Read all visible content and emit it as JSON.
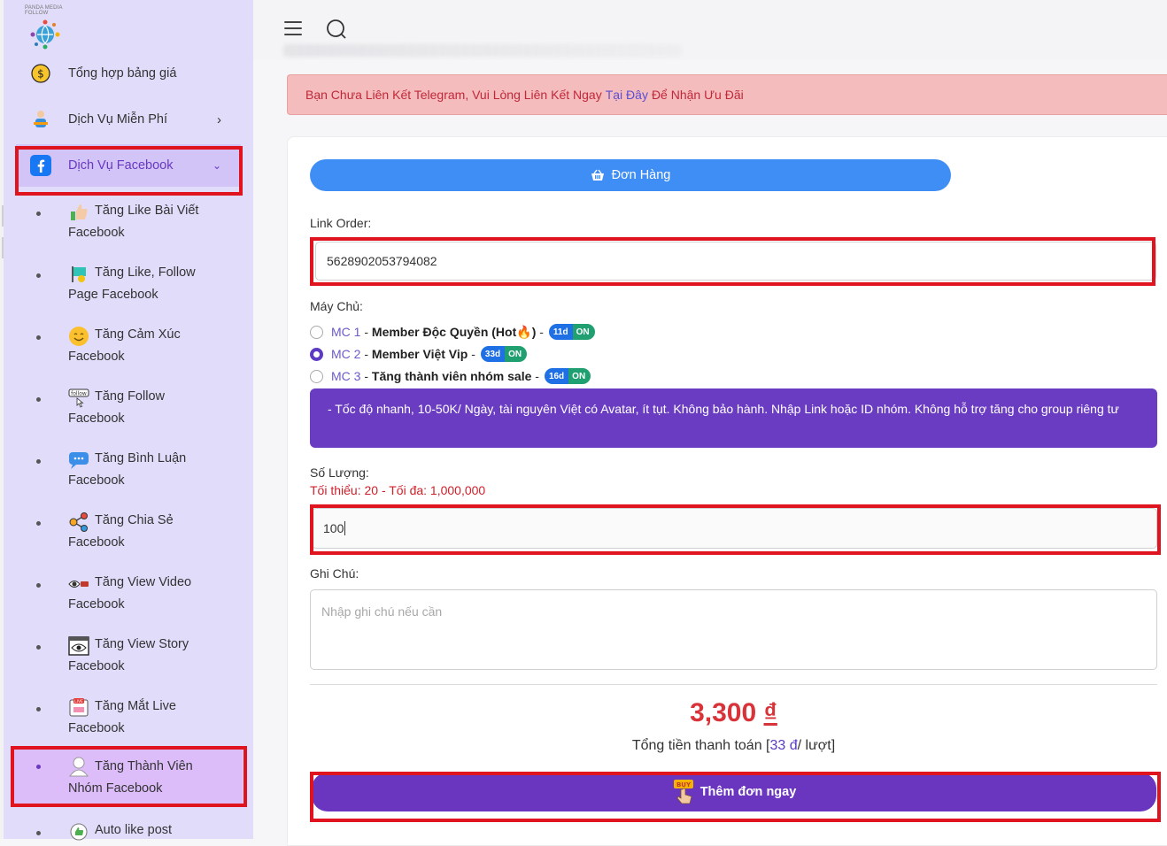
{
  "sidebar": {
    "logo_text": "PANDA MEDIA FOLLOW",
    "items": [
      {
        "label": "Tổng hợp bảng giá",
        "icon": "dollar-coin-icon"
      },
      {
        "label": "Dịch Vụ Miễn Phí",
        "icon": "free-service-icon",
        "chevron": "›"
      },
      {
        "label": "Dịch Vụ Facebook",
        "icon": "facebook-icon",
        "chevron": "⌄"
      }
    ],
    "subitems": [
      {
        "line1": "Tăng Like Bài Viết",
        "line2": "Facebook",
        "icon": "thumbs-up-icon"
      },
      {
        "line1": "Tăng Like, Follow",
        "line2": "Page Facebook",
        "icon": "flag-icon"
      },
      {
        "line1": "Tăng Cảm Xúc",
        "line2": "Facebook",
        "icon": "emoji-icon"
      },
      {
        "line1": "Tăng Follow",
        "line2": "Facebook",
        "icon": "follow-icon"
      },
      {
        "line1": "Tăng Bình Luận",
        "line2": "Facebook",
        "icon": "comment-icon"
      },
      {
        "line1": "Tăng Chia Sẻ",
        "line2": "Facebook",
        "icon": "share-icon"
      },
      {
        "line1": "Tăng View Video",
        "line2": "Facebook",
        "icon": "eye-icon"
      },
      {
        "line1": "Tăng View Story",
        "line2": "Facebook",
        "icon": "story-eye-icon"
      },
      {
        "line1": "Tăng Mắt Live",
        "line2": "Facebook",
        "icon": "live-icon"
      },
      {
        "line1": "Tăng Thành Viên",
        "line2": "Nhóm Facebook",
        "icon": "member-icon"
      },
      {
        "line1": "Auto like post",
        "line2": "",
        "icon": "auto-like-icon"
      }
    ]
  },
  "alert": {
    "before": "Bạn Chưa Liên Kết Telegram, Vui Lòng Liên Kết Ngay",
    "link": "Tại Đây",
    "after": "Để Nhận Ưu Đãi"
  },
  "form": {
    "order_button": "Đơn Hàng",
    "link_label": "Link Order:",
    "link_value": "5628902053794082",
    "server_label": "Máy Chủ:",
    "servers": [
      {
        "code": "MC 1",
        "name": "Member Độc Quyền (Hot🔥)",
        "days": "11d",
        "status": "ON",
        "selected": false
      },
      {
        "code": "MC 2",
        "name": "Member Việt Vip",
        "days": "33d",
        "status": "ON",
        "selected": true
      },
      {
        "code": "MC 3",
        "name": "Tăng thành viên nhóm sale",
        "days": "16d",
        "status": "ON",
        "selected": false
      }
    ],
    "description": "- Tốc độ nhanh, 10-50K/ Ngày, tài nguyên Việt có Avatar, ít tụt. Không bảo hành. Nhập Link hoặc ID nhóm. Không hỗ trợ tăng cho group riêng tư",
    "quantity_label": "Số Lượng:",
    "quantity_limits": "Tối thiểu: 20 - Tối đa: 1,000,000",
    "quantity_value": "100",
    "note_label": "Ghi Chú:",
    "note_placeholder": "Nhập ghi chú nếu cần",
    "price": "3,300",
    "currency": "₫",
    "total_prefix": "Tổng tiền thanh toán [",
    "total_unit_price": "33 đ",
    "total_suffix": "/ lượt]",
    "submit_button": "Thêm đơn ngay"
  },
  "colors": {
    "sidebar_bg": "#e2dcfb",
    "accent_purple": "#6a36c0",
    "primary_blue": "#3f8ef5",
    "price_red": "#d9333a",
    "alert_bg": "#f4bcbc",
    "highlight_red": "#e0141e"
  }
}
